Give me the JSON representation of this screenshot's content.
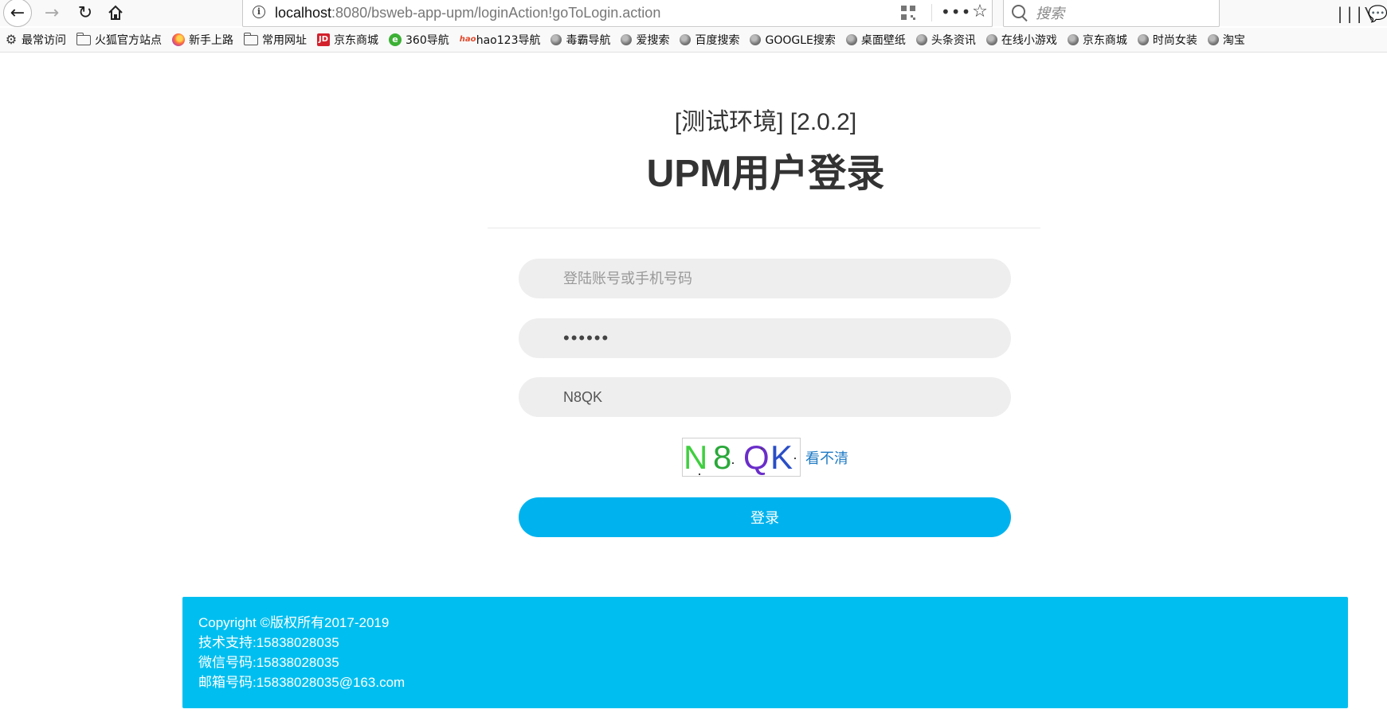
{
  "browser": {
    "url_host": "localhost",
    "url_rest": ":8080/bsweb-app-upm/loginAction!goToLogin.action",
    "search_placeholder": "搜索",
    "bookmarks": [
      {
        "label": "最常访问",
        "icon": "gear-icon"
      },
      {
        "label": "火狐官方站点",
        "icon": "folder-icon"
      },
      {
        "label": "新手上路",
        "icon": "firefox-icon"
      },
      {
        "label": "常用网址",
        "icon": "folder-icon"
      },
      {
        "label": "京东商城",
        "icon": "jd-icon"
      },
      {
        "label": "360导航",
        "icon": "360-icon"
      },
      {
        "label": "hao123导航",
        "icon": "hao123-icon"
      },
      {
        "label": "毒霸导航",
        "icon": "globe-icon"
      },
      {
        "label": "爱搜索",
        "icon": "globe-icon"
      },
      {
        "label": "百度搜索",
        "icon": "globe-icon"
      },
      {
        "label": "GOOGLE搜索",
        "icon": "globe-icon"
      },
      {
        "label": "桌面壁纸",
        "icon": "globe-icon"
      },
      {
        "label": "头条资讯",
        "icon": "globe-icon"
      },
      {
        "label": "在线小游戏",
        "icon": "globe-icon"
      },
      {
        "label": "京东商城",
        "icon": "globe-icon"
      },
      {
        "label": "时尚女装",
        "icon": "globe-icon"
      },
      {
        "label": "淘宝",
        "icon": "globe-icon"
      }
    ]
  },
  "login": {
    "env_tag": "[测试环境] [2.0.2]",
    "title": "UPM用户登录",
    "username_placeholder": "登陆账号或手机号码",
    "username_value": "",
    "password_value": "••••••",
    "captcha_value": "N8QK",
    "captcha_chars": [
      "N",
      "8",
      "Q",
      "K"
    ],
    "refresh_captcha_label": "看不清",
    "submit_label": "登录"
  },
  "footer": {
    "copyright": "Copyright ©版权所有2017-2019",
    "support": "技术支持:15838028035",
    "wechat": "微信号码:15838028035",
    "email": "邮箱号码:15838028035@163.com"
  },
  "colors": {
    "primary_button": "#00b3ee",
    "footer_bg": "#00bff0",
    "link": "#1e7ac4",
    "input_bg": "#eeeeee"
  }
}
